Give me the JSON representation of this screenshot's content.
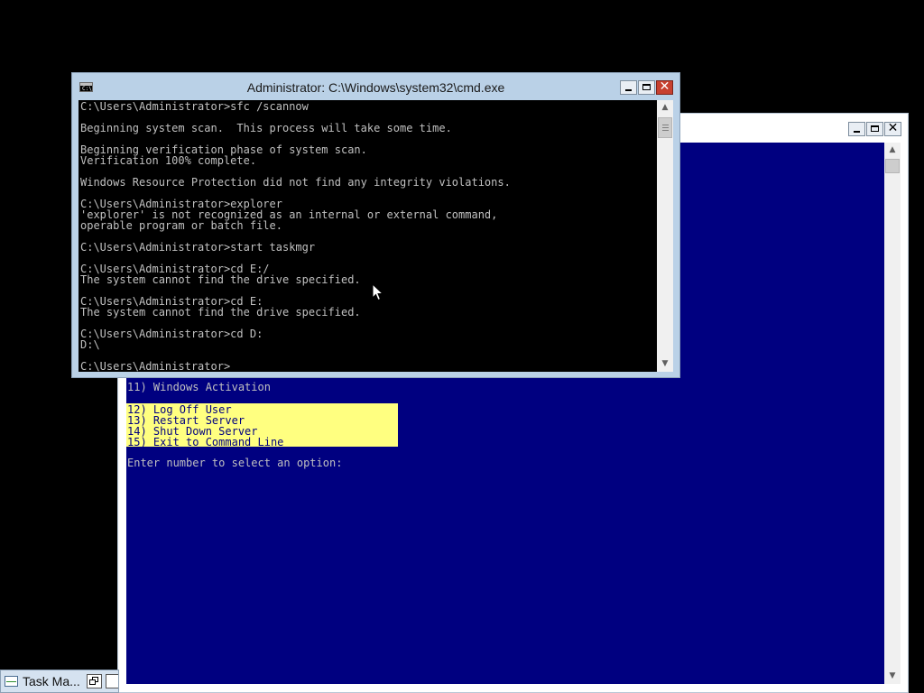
{
  "cmd_window": {
    "title": "Administrator: C:\\Windows\\system32\\cmd.exe",
    "icon_text": "C:\\",
    "lines": [
      "C:\\Users\\Administrator>sfc /scannow",
      "",
      "Beginning system scan.  This process will take some time.",
      "",
      "Beginning verification phase of system scan.",
      "Verification 100% complete.",
      "",
      "Windows Resource Protection did not find any integrity violations.",
      "",
      "C:\\Users\\Administrator>explorer",
      "'explorer' is not recognized as an internal or external command,",
      "operable program or batch file.",
      "",
      "C:\\Users\\Administrator>start taskmgr",
      "",
      "C:\\Users\\Administrator>cd E:/",
      "The system cannot find the drive specified.",
      "",
      "C:\\Users\\Administrator>cd E:",
      "The system cannot find the drive specified.",
      "",
      "C:\\Users\\Administrator>cd D:",
      "D:\\",
      "",
      "C:\\Users\\Administrator>"
    ]
  },
  "sconfig_window": {
    "menu_item_11": "11) Windows Activation",
    "highlighted_items": [
      "12) Log Off User",
      "13) Restart Server",
      "14) Shut Down Server",
      "15) Exit to Command Line"
    ],
    "prompt": "Enter number to select an option:"
  },
  "taskbar": {
    "task_label": "Task Ma..."
  },
  "icons": {
    "cmd_icon": "console-icon",
    "minimize": "minimize-icon",
    "maximize": "maximize-icon",
    "close": "close-icon",
    "task_manager": "task-manager-icon",
    "restore": "restore-icon",
    "mouse_cursor": "cursor-icon"
  },
  "colors": {
    "console_bg": "#000000",
    "console_text": "#c0c0c0",
    "sconfig_bg": "#000080",
    "highlight_bg": "#ffff80",
    "close_button": "#c7402f",
    "titlebar": "#bad1e7"
  }
}
